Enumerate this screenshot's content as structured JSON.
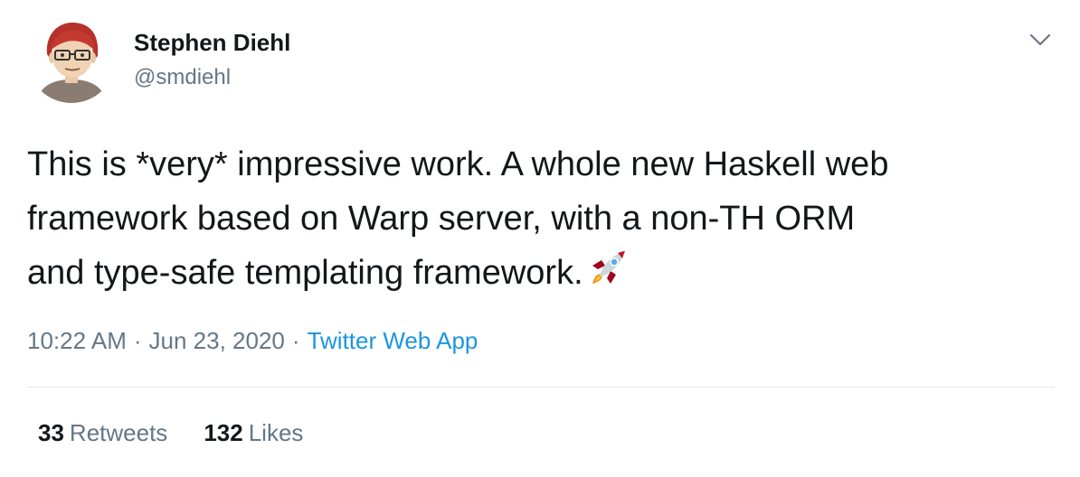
{
  "author": {
    "display_name": "Stephen Diehl",
    "handle": "@smdiehl",
    "avatar_icon": "cartoon-avatar-icon"
  },
  "menu": {
    "icon": "chevron-down-icon"
  },
  "tweet": {
    "lines": [
      "This is *very* impressive work. A whole new Haskell web",
      "framework based on Warp server, with a non-TH ORM",
      "and type-safe templating framework."
    ],
    "emoji": "rocket-icon"
  },
  "meta": {
    "time": "10:22 AM",
    "separator": "·",
    "date": "Jun 23, 2020",
    "source": "Twitter Web App"
  },
  "stats": {
    "retweets_count": "33",
    "retweets_label": "Retweets",
    "likes_count": "132",
    "likes_label": "Likes"
  },
  "colors": {
    "text": "#14171a",
    "secondary": "#657786",
    "link": "#1b95e0",
    "divider": "#e1e8ed"
  }
}
